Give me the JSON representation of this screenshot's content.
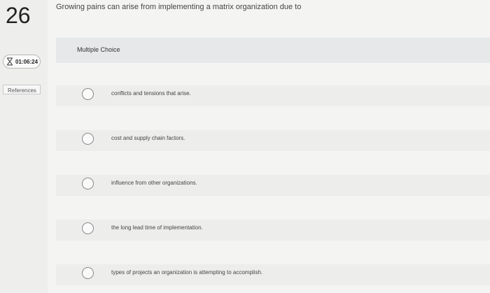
{
  "question": {
    "number": "26",
    "text": "Growing pains can arise from implementing a matrix organization due to"
  },
  "timer": {
    "icon": "hourglass-icon",
    "time": "01:06:24"
  },
  "references": {
    "label": "References"
  },
  "choice": {
    "type_label": "Multiple Choice",
    "options": [
      {
        "text": "conflicts and tensions that arise."
      },
      {
        "text": "cost and supply chain factors."
      },
      {
        "text": "influence from other organizations."
      },
      {
        "text": "the long lead time of implementation."
      },
      {
        "text": "types of projects an organization is attempting to accomplish."
      }
    ]
  }
}
